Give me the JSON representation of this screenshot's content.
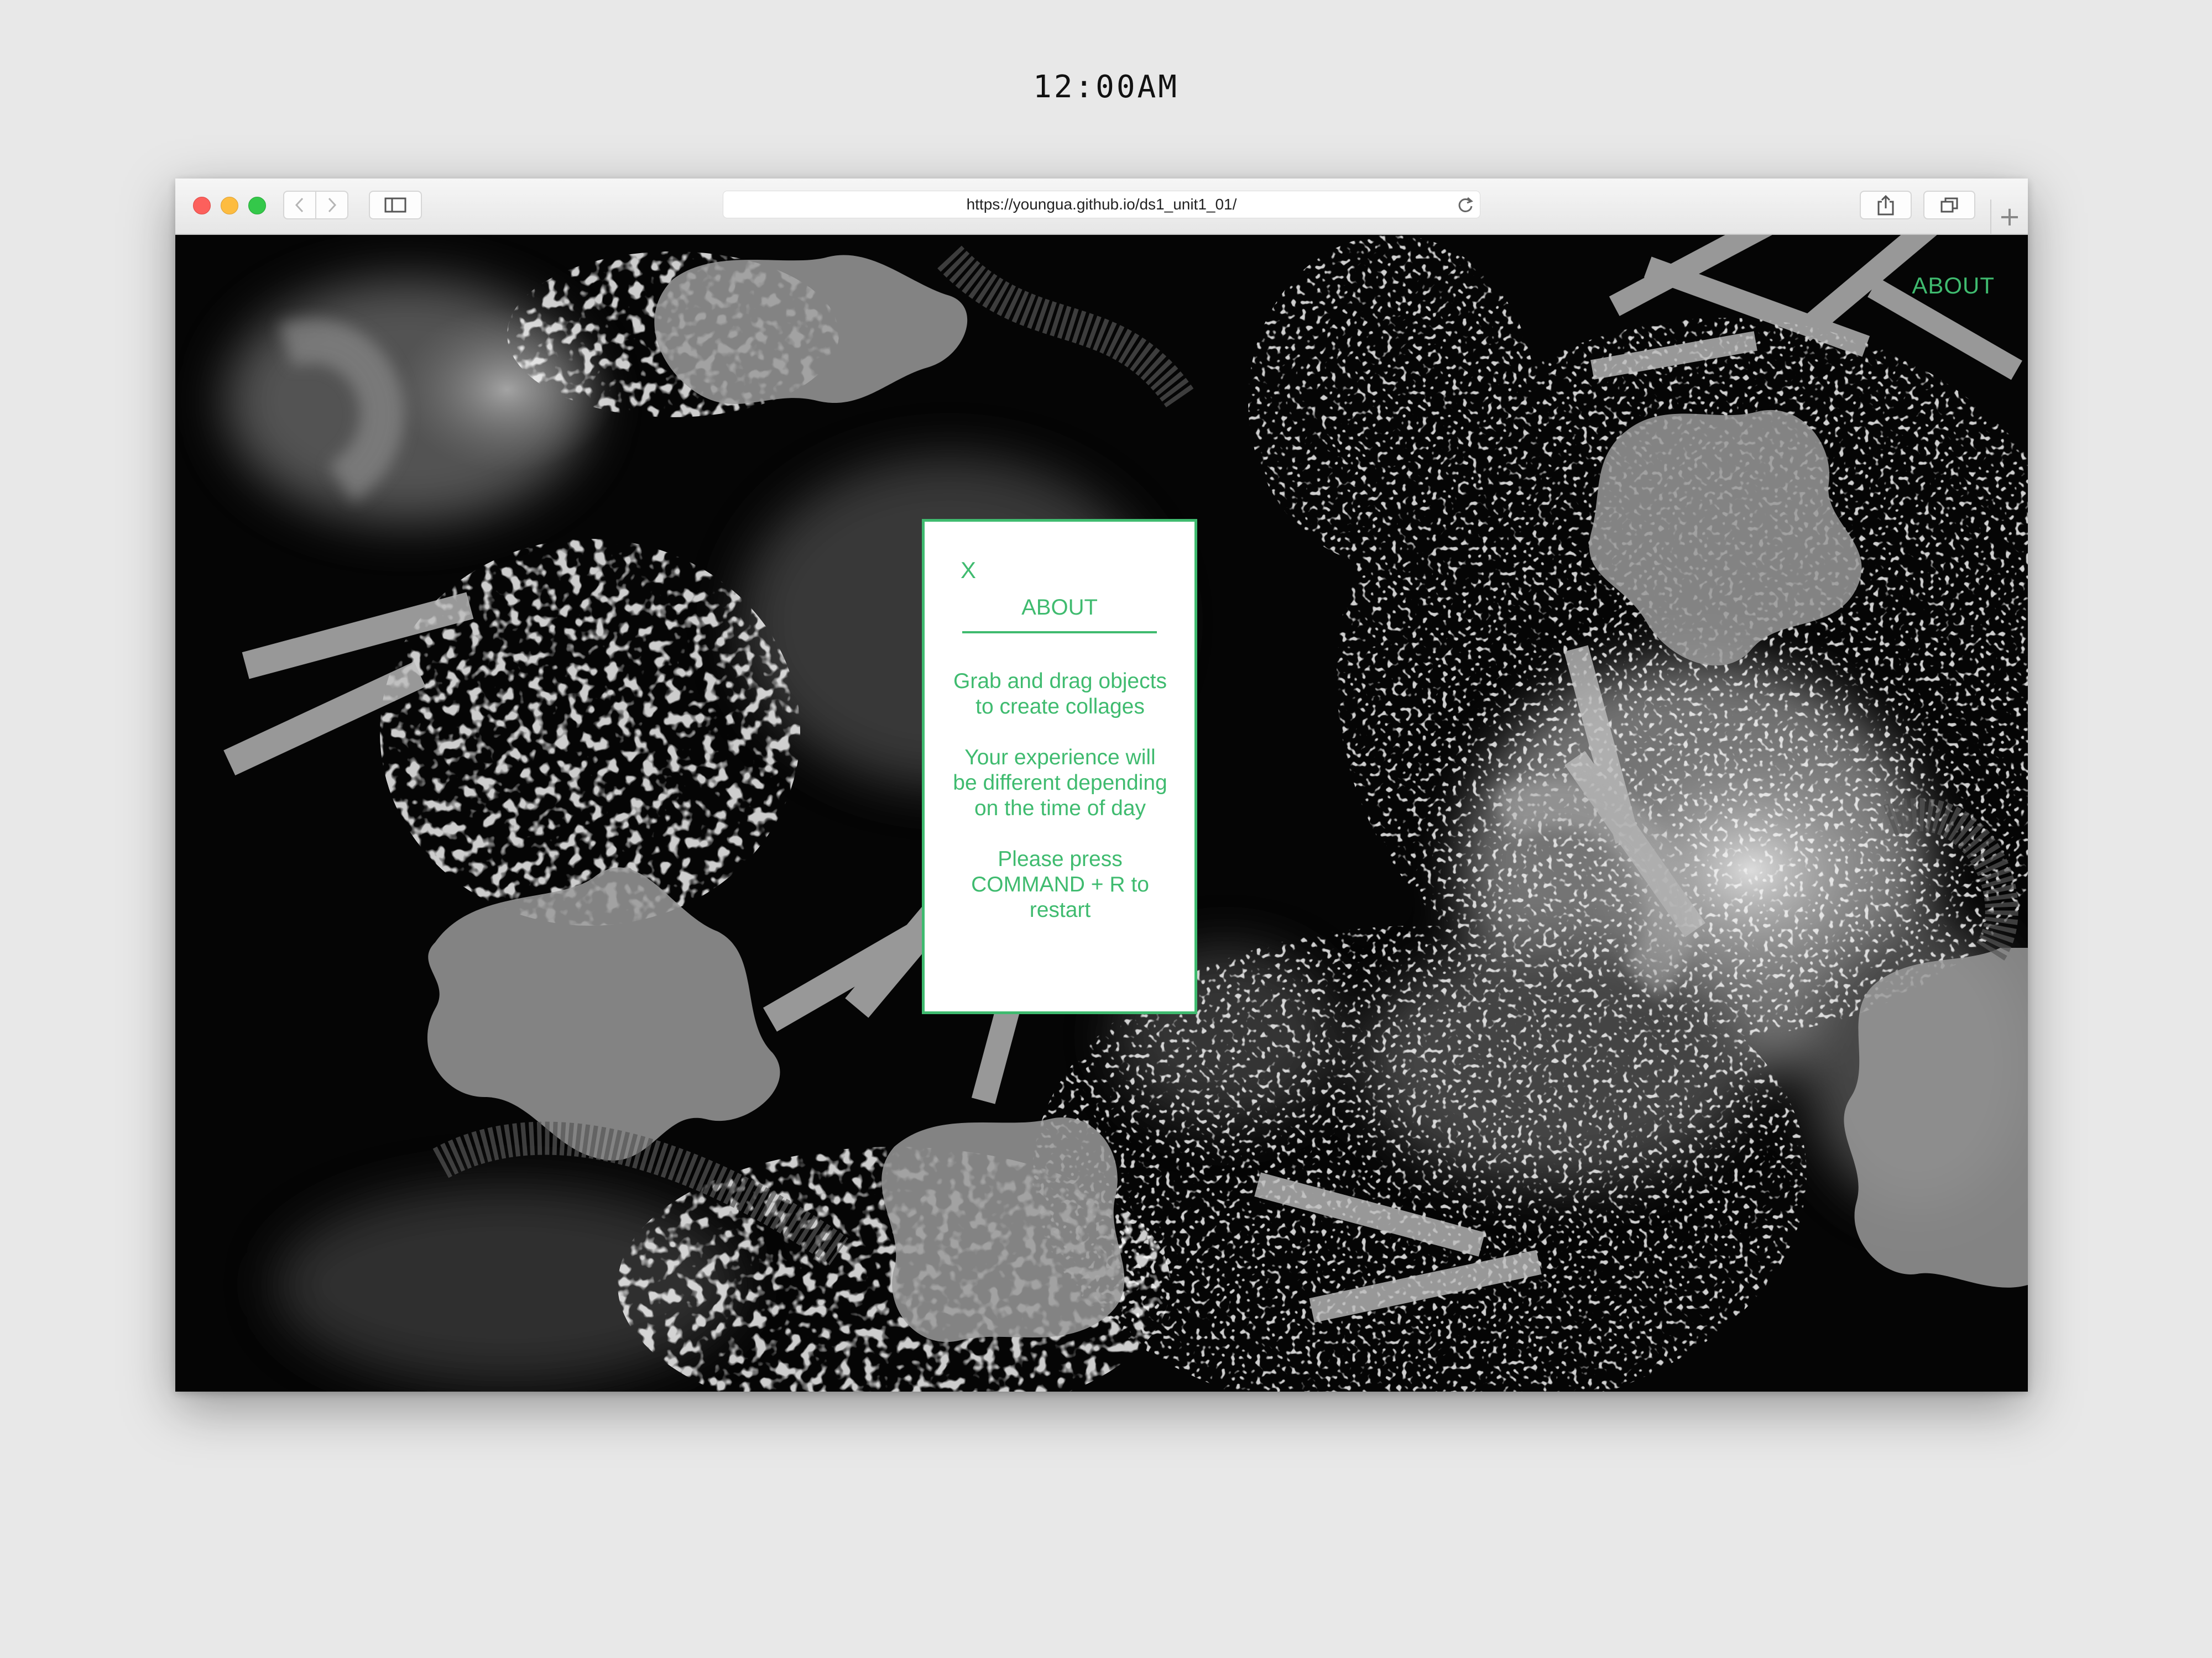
{
  "clock": "12:00AM",
  "browser": {
    "url": "https://youngua.github.io/ds1_unit1_01/",
    "icons": [
      "back-icon",
      "forward-icon",
      "sidebar-icon",
      "reload-icon",
      "share-icon",
      "tabs-icon",
      "new-tab-icon"
    ],
    "new_tab_glyph": "+"
  },
  "page": {
    "nav_about": "ABOUT",
    "modal": {
      "close": "X",
      "title": "ABOUT",
      "paragraphs": [
        "Grab and drag objects to create collages",
        "Your experience will be different depending on the time of day",
        "Please press COMMAND + R to restart"
      ]
    }
  },
  "colors": {
    "accent": "#3fbb6f",
    "page_background": "#000000",
    "desktop": "#e8e8e8"
  }
}
